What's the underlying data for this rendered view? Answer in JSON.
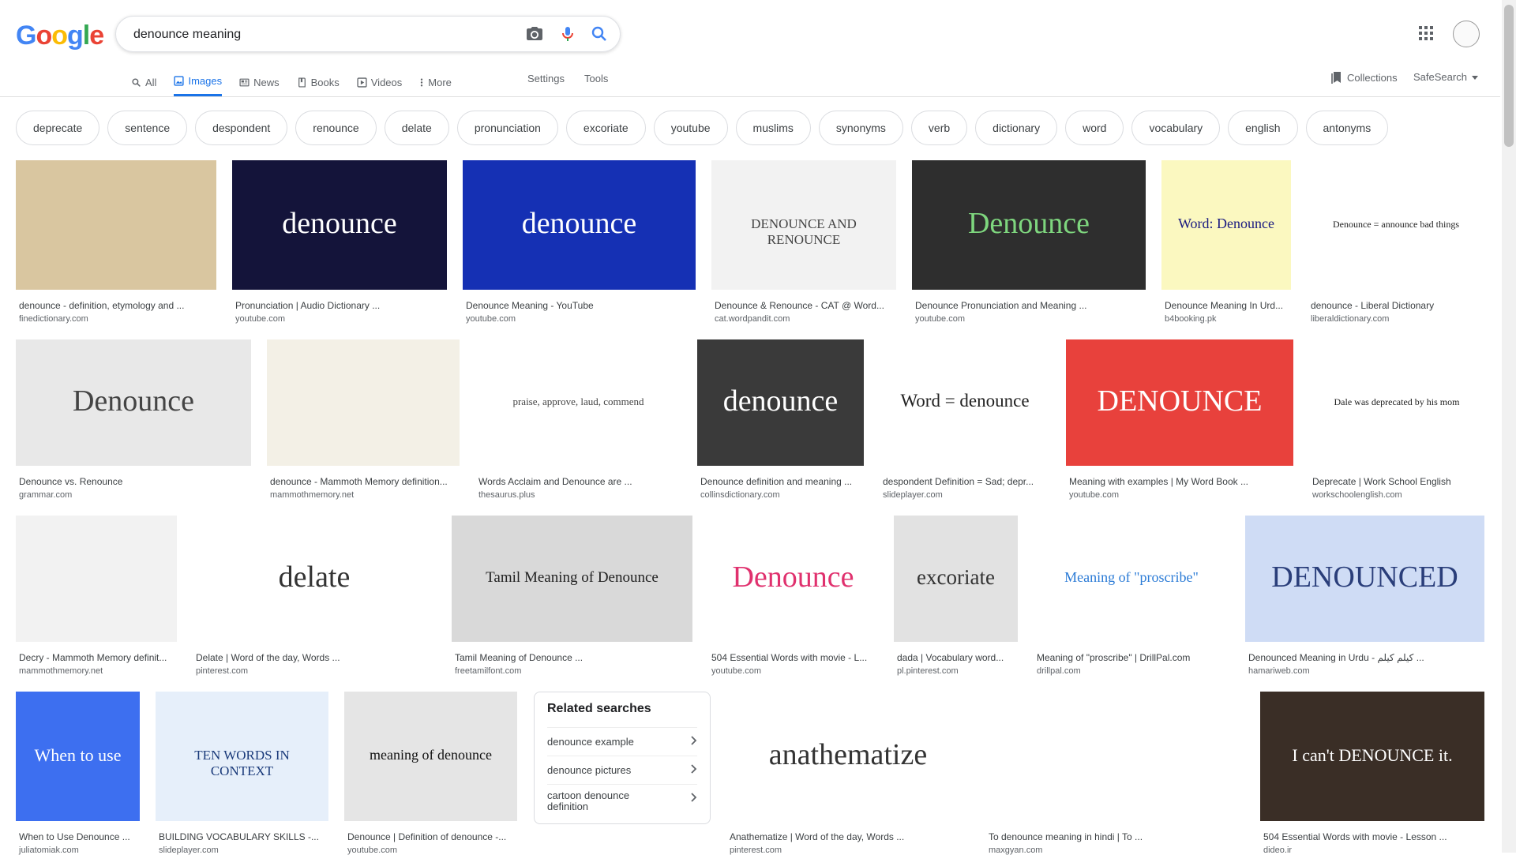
{
  "logo": {
    "letters": [
      "G",
      "o",
      "o",
      "g",
      "l",
      "e"
    ],
    "colors": [
      "#4285F4",
      "#EA4335",
      "#FBBC05",
      "#4285F4",
      "#34A853",
      "#EA4335"
    ]
  },
  "search": {
    "query": "denounce meaning"
  },
  "tabs": [
    {
      "label": "All",
      "icon": "search-icon"
    },
    {
      "label": "Images",
      "icon": "image-icon",
      "active": true
    },
    {
      "label": "News",
      "icon": "news-icon"
    },
    {
      "label": "Books",
      "icon": "book-icon"
    },
    {
      "label": "Videos",
      "icon": "video-icon"
    },
    {
      "label": "More",
      "icon": "more-vert-icon"
    }
  ],
  "tools": {
    "settings": "Settings",
    "tools": "Tools"
  },
  "header_right": {
    "collections": "Collections",
    "safesearch": "SafeSearch"
  },
  "chips": [
    "deprecate",
    "sentence",
    "despondent",
    "renounce",
    "delate",
    "pronunciation",
    "excoriate",
    "youtube",
    "muslims",
    "synonyms",
    "verb",
    "dictionary",
    "word",
    "vocabulary",
    "english",
    "antonyms"
  ],
  "results": [
    {
      "caption": "denounce - definition, etymology and ...",
      "source": "finedictionary.com",
      "thumb_text": "",
      "bg": "#d9c6a0",
      "fg": "#333"
    },
    {
      "caption": "Pronunciation | Audio Dictionary ...",
      "source": "youtube.com",
      "thumb_text": "denounce",
      "bg": "#14143a",
      "fg": "#ffffff"
    },
    {
      "caption": "Denounce Meaning - YouTube",
      "source": "youtube.com",
      "thumb_text": "denounce",
      "bg": "#1530b4",
      "fg": "#ffffff"
    },
    {
      "caption": "Denounce & Renounce - CAT @ Word...",
      "source": "cat.wordpandit.com",
      "thumb_text": "DENOUNCE AND RENOUNCE",
      "bg": "#f2f2f2",
      "fg": "#444"
    },
    {
      "caption": "Denounce Pronunciation and Meaning ...",
      "source": "youtube.com",
      "thumb_text": "Denounce",
      "bg": "#2e2e2e",
      "fg": "#7ed67e"
    },
    {
      "caption": "Denounce Meaning In Urd...",
      "source": "b4booking.pk",
      "thumb_text": "Word: Denounce",
      "bg": "#fbf8c0",
      "fg": "#1a1a80"
    },
    {
      "caption": "denounce - Liberal Dictionary",
      "source": "liberaldictionary.com",
      "thumb_text": "Denounce = announce bad things",
      "bg": "#ffffff",
      "fg": "#222"
    },
    {
      "caption": "Denounce vs. Renounce",
      "source": "grammar.com",
      "thumb_text": "Denounce",
      "bg": "#e8e8e8",
      "fg": "#444"
    },
    {
      "caption": "denounce - Mammoth Memory definition...",
      "source": "mammothmemory.net",
      "thumb_text": "",
      "bg": "#f3f0e6",
      "fg": "#333"
    },
    {
      "caption": "Words Acclaim and Denounce are ...",
      "source": "thesaurus.plus",
      "thumb_text": "praise, approve, laud, commend",
      "bg": "#ffffff",
      "fg": "#444"
    },
    {
      "caption": "Denounce definition and meaning ...",
      "source": "collinsdictionary.com",
      "thumb_text": "denounce",
      "bg": "#3a3a3a",
      "fg": "#ffffff"
    },
    {
      "caption": "despondent Definition = Sad; depr...",
      "source": "slideplayer.com",
      "thumb_text": "Word = denounce",
      "bg": "#ffffff",
      "fg": "#222"
    },
    {
      "caption": "Meaning with examples | My Word Book ...",
      "source": "youtube.com",
      "thumb_text": "DENOUNCE",
      "bg": "#e8413c",
      "fg": "#ffffff"
    },
    {
      "caption": "Deprecate | Work School English",
      "source": "workschoolenglish.com",
      "thumb_text": "Dale was deprecated by his mom",
      "bg": "#ffffff",
      "fg": "#222"
    },
    {
      "caption": "Decry - Mammoth Memory definit...",
      "source": "mammothmemory.net",
      "thumb_text": "",
      "bg": "#f2f2f2",
      "fg": "#333"
    },
    {
      "caption": "Delate | Word of the day, Words ...",
      "source": "pinterest.com",
      "thumb_text": "delate",
      "bg": "#ffffff",
      "fg": "#333"
    },
    {
      "caption": "Tamil Meaning of Denounce ...",
      "source": "freetamilfont.com",
      "thumb_text": "Tamil Meaning of Denounce",
      "bg": "#d9d9d9",
      "fg": "#222"
    },
    {
      "caption": "504 Essential Words with movie - L...",
      "source": "youtube.com",
      "thumb_text": "Denounce",
      "bg": "#ffffff",
      "fg": "#e0316e"
    },
    {
      "caption": "dada | Vocabulary word...",
      "source": "pl.pinterest.com",
      "thumb_text": "excoriate",
      "bg": "#e2e2e2",
      "fg": "#333"
    },
    {
      "caption": "Meaning of \"proscribe\" | DrillPal.com",
      "source": "drillpal.com",
      "thumb_text": "Meaning of \"proscribe\"",
      "bg": "#ffffff",
      "fg": "#2b7bd6"
    },
    {
      "caption": "Denounced Meaning in Urdu - کیلم کیلم ...",
      "source": "hamariweb.com",
      "thumb_text": "DENOUNCED",
      "bg": "#cfdcf5",
      "fg": "#2a3e7a"
    },
    {
      "caption": "When to Use Denounce ...",
      "source": "juliatomiak.com",
      "thumb_text": "When to use",
      "bg": "#3d6ff0",
      "fg": "#ffffff"
    },
    {
      "caption": "BUILDING VOCABULARY SKILLS -...",
      "source": "slideplayer.com",
      "thumb_text": "TEN WORDS IN CONTEXT",
      "bg": "#e6effa",
      "fg": "#1a3a7a"
    },
    {
      "caption": "Denounce | Definition of denounce -...",
      "source": "youtube.com",
      "thumb_text": "meaning of denounce",
      "bg": "#e5e5e5",
      "fg": "#111"
    },
    {
      "caption": "Anathematize | Word of the day, Words ...",
      "source": "pinterest.com",
      "thumb_text": "anathematize",
      "bg": "#ffffff",
      "fg": "#333"
    },
    {
      "caption": "To denounce meaning in hindi | To ...",
      "source": "maxgyan.com",
      "thumb_text": "",
      "bg": "#ffffff",
      "fg": "#333"
    },
    {
      "caption": "504 Essential Words with movie - Lesson ...",
      "source": "dideo.ir",
      "thumb_text": "I can't DENOUNCE it.",
      "bg": "#3a2e26",
      "fg": "#ffffff"
    }
  ],
  "related": {
    "title": "Related searches",
    "items": [
      "denounce example",
      "denounce pictures",
      "cartoon denounce definition"
    ]
  }
}
